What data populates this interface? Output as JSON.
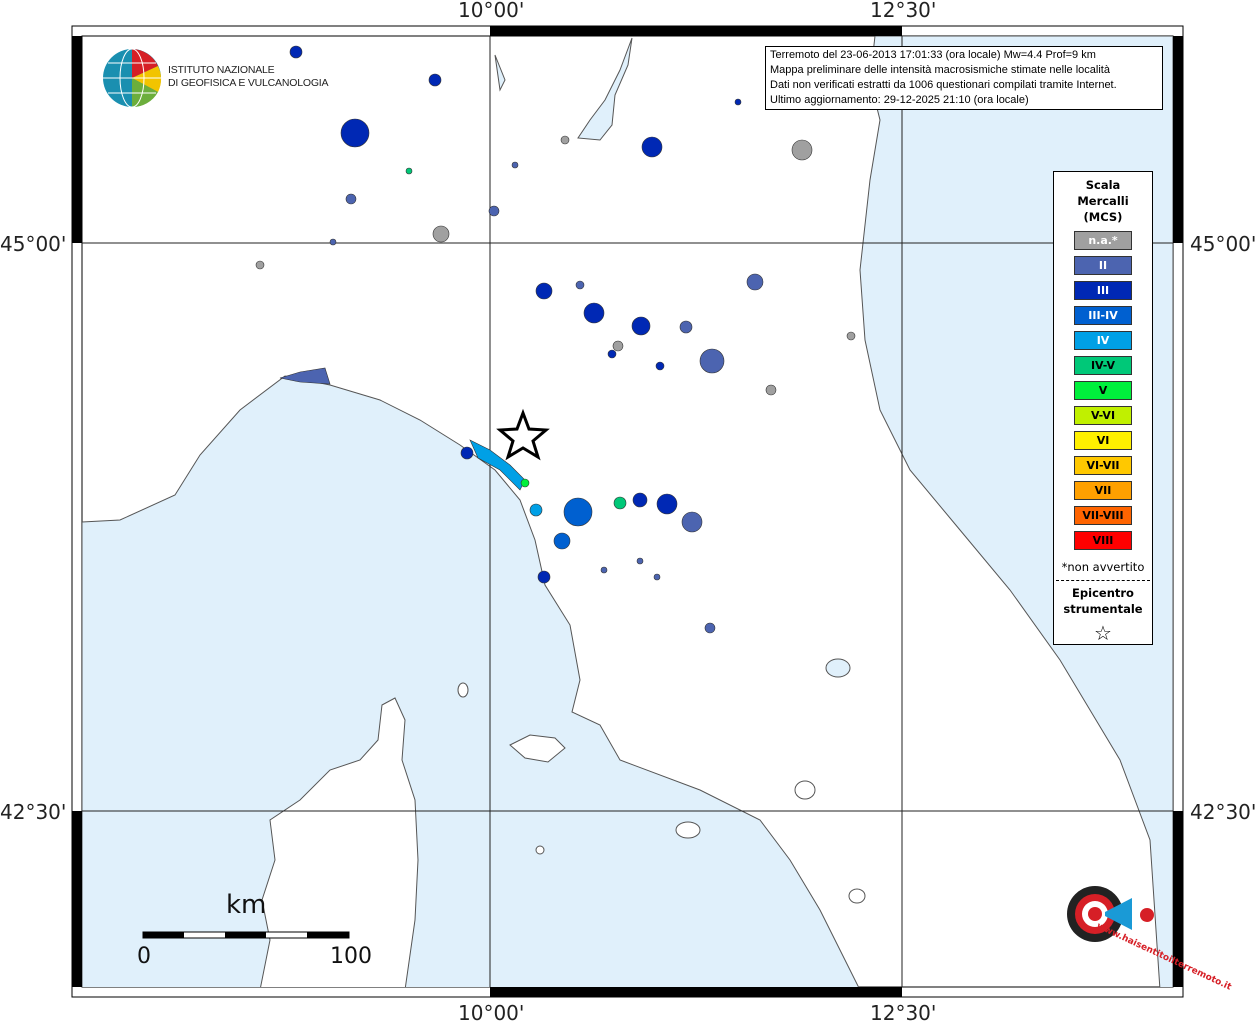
{
  "axes": {
    "top": [
      "10°00'",
      "12°30'"
    ],
    "bottom": [
      "10°00'",
      "12°30'"
    ],
    "left": [
      "45°00'",
      "42°30'"
    ],
    "right": [
      "45°00'",
      "42°30'"
    ]
  },
  "info_box": {
    "line1": "Terremoto del 23-06-2013 17:01:33 (ora locale) Mw=4.4 Prof=9 km",
    "line2": "Mappa preliminare delle intensità macrosismiche stimate nelle località",
    "line3": "Dati non verificati estratti da 1006 questionari compilati tramite Internet.",
    "line4": "Ultimo aggiornamento: 29-12-2025 21:10 (ora locale)"
  },
  "logo": {
    "line1": "ISTITUTO NAZIONALE",
    "line2": "DI GEOFISICA E VULCANOLOGIA"
  },
  "logo2": {
    "text": "www.haisentitoilterremoto.it"
  },
  "legend": {
    "title1": "Scala",
    "title2": "Mercalli",
    "title3": "(MCS)",
    "classes": [
      {
        "label": "n.a.*",
        "color": "#a0a0a0",
        "text": "#ffffff"
      },
      {
        "label": "II",
        "color": "#4c64b0",
        "text": "#ffffff"
      },
      {
        "label": "III",
        "color": "#0028b4",
        "text": "#ffffff"
      },
      {
        "label": "III-IV",
        "color": "#0060d0",
        "text": "#ffffff"
      },
      {
        "label": "IV",
        "color": "#00a0e6",
        "text": "#ffffff"
      },
      {
        "label": "IV-V",
        "color": "#00c878",
        "text": "#000000"
      },
      {
        "label": "V",
        "color": "#00f03c",
        "text": "#000000"
      },
      {
        "label": "V-VI",
        "color": "#c0f000",
        "text": "#000000"
      },
      {
        "label": "VI",
        "color": "#fff000",
        "text": "#000000"
      },
      {
        "label": "VI-VII",
        "color": "#ffc800",
        "text": "#000000"
      },
      {
        "label": "VII",
        "color": "#ffa000",
        "text": "#000000"
      },
      {
        "label": "VII-VIII",
        "color": "#ff6400",
        "text": "#000000"
      },
      {
        "label": "VIII",
        "color": "#ff0000",
        "text": "#000000"
      }
    ],
    "note": "*non avvertito",
    "epicenter1": "Epicentro",
    "epicenter2": "strumentale",
    "star": "☆"
  },
  "scale_bar": {
    "unit": "km",
    "min": "0",
    "max": "100"
  },
  "colors": {
    "sea": "#e0f0fb",
    "land": "#ffffff"
  }
}
